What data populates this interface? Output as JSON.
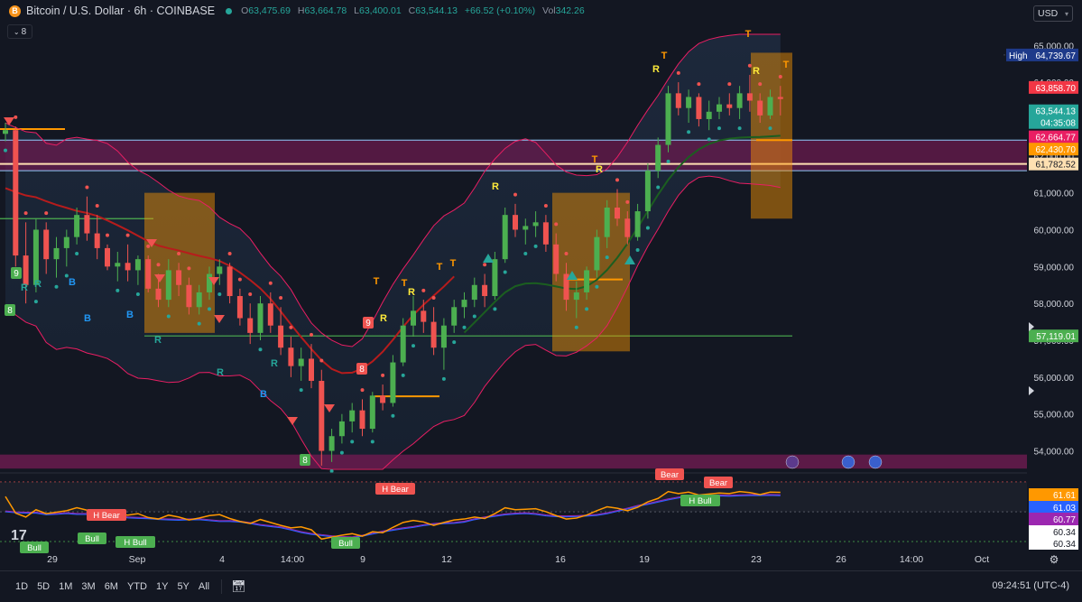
{
  "header": {
    "symbol_title": "Bitcoin / U.S. Dollar · 6h · COINBASE",
    "coin_glyph": "B",
    "open_label": "O",
    "open": "63,475.69",
    "high_label": "H",
    "high": "63,664.78",
    "low_label": "L",
    "low": "63,400.01",
    "close_label": "C",
    "close": "63,544.13",
    "change": "+66.52 (+0.10%)",
    "vol_label": "Vol",
    "vol": "342.26",
    "currency": "USD",
    "indicator_count": "8"
  },
  "price_axis": {
    "ticks": [
      "65,000.00",
      "64,000.00",
      "63,000.00",
      "62,000.00",
      "61,000.00",
      "60,000.00",
      "59,000.00",
      "58,000.00",
      "57,000.00",
      "56,000.00",
      "55,000.00",
      "54,000.00"
    ],
    "high_label": "High",
    "high_value": "64,739.67",
    "badges": [
      {
        "text": "63,858.70",
        "color": "#f23645"
      },
      {
        "text": "63,544.13",
        "color": "#26a69a"
      },
      {
        "text": "04:35:08",
        "color": "#26a69a"
      },
      {
        "text": "62,664.77",
        "color": "#e91e63"
      },
      {
        "text": "62,430.70",
        "color": "#ff9800"
      },
      {
        "text": "61,782.52",
        "color": "#ffe0b2"
      },
      {
        "text": "57,119.01",
        "color": "#4caf50"
      }
    ]
  },
  "osc_axis": {
    "badges": [
      {
        "text": "61.61",
        "color": "#ff9800"
      },
      {
        "text": "61.03",
        "color": "#2962ff"
      },
      {
        "text": "60.77",
        "color": "#9c27b0"
      },
      {
        "text": "60.34",
        "color": "#ffffff"
      },
      {
        "text": "60.34",
        "color": "#ffffff"
      }
    ]
  },
  "time_axis": {
    "ticks": [
      "29",
      "Sep",
      "4",
      "14:00",
      "9",
      "12",
      "16",
      "19",
      "23",
      "26",
      "14:00",
      "Oct"
    ]
  },
  "signals": {
    "R": "R",
    "T": "T",
    "B": "B",
    "nine": "9",
    "eight": "8",
    "h_bear": "H Bear",
    "h_bull": "H Bull",
    "bull": "Bull",
    "bear": "Bear"
  },
  "bottom_bar": {
    "timeframes": [
      "1D",
      "5D",
      "1M",
      "3M",
      "6M",
      "YTD",
      "1Y",
      "5Y",
      "All"
    ],
    "clock": "09:24:51 (UTC-4)"
  },
  "colors": {
    "up": "#26a69a",
    "down": "#ef5350",
    "background": "#131722",
    "band": "#e91e63",
    "ma": "#b71c1c",
    "green_ma": "#1b5e20",
    "orange": "#ff9800"
  },
  "chart_data": {
    "type": "candlestick",
    "title": "Bitcoin / U.S. Dollar · 6h · COINBASE",
    "ylim": [
      53500,
      65300
    ],
    "candles": [
      [
        62600,
        62900,
        62400,
        62700
      ],
      [
        62700,
        62800,
        59000,
        59300
      ],
      [
        59300,
        60200,
        58000,
        58500
      ],
      [
        58500,
        60300,
        58300,
        60000
      ],
      [
        60000,
        60200,
        58800,
        59200
      ],
      [
        59200,
        59800,
        58700,
        59500
      ],
      [
        59500,
        60000,
        59000,
        59800
      ],
      [
        59800,
        60600,
        59600,
        60400
      ],
      [
        60400,
        60900,
        59700,
        59900
      ],
      [
        59900,
        60400,
        59200,
        59500
      ],
      [
        59500,
        59600,
        58900,
        59000
      ],
      [
        59000,
        59400,
        58600,
        59100
      ],
      [
        59100,
        59600,
        58600,
        58900
      ],
      [
        58900,
        59300,
        58500,
        59200
      ],
      [
        59200,
        59300,
        58300,
        58400
      ],
      [
        58400,
        58800,
        57900,
        58100
      ],
      [
        58100,
        59200,
        57900,
        58900
      ],
      [
        58900,
        59100,
        58200,
        58500
      ],
      [
        58500,
        58700,
        57700,
        57900
      ],
      [
        57900,
        58500,
        57700,
        58300
      ],
      [
        58300,
        59000,
        58100,
        58800
      ],
      [
        58800,
        59200,
        58500,
        59000
      ],
      [
        59000,
        59100,
        58000,
        58200
      ],
      [
        58200,
        58400,
        57400,
        57600
      ],
      [
        57600,
        58000,
        56900,
        57200
      ],
      [
        57200,
        58200,
        57000,
        58000
      ],
      [
        58000,
        58300,
        57200,
        57400
      ],
      [
        57400,
        57900,
        56600,
        56800
      ],
      [
        56800,
        57100,
        56000,
        56300
      ],
      [
        56300,
        56800,
        55900,
        56500
      ],
      [
        56500,
        56900,
        55700,
        55900
      ],
      [
        55900,
        56200,
        53600,
        54000
      ],
      [
        54000,
        54600,
        53700,
        54400
      ],
      [
        54400,
        55000,
        54200,
        54800
      ],
      [
        54800,
        55300,
        54500,
        55100
      ],
      [
        55100,
        55400,
        54400,
        54600
      ],
      [
        54600,
        55600,
        54500,
        55500
      ],
      [
        55500,
        55800,
        55100,
        55300
      ],
      [
        55300,
        56600,
        55200,
        56400
      ],
      [
        56400,
        57600,
        56300,
        57400
      ],
      [
        57400,
        58200,
        57100,
        57800
      ],
      [
        57800,
        58100,
        57200,
        57500
      ],
      [
        57500,
        57900,
        56600,
        56800
      ],
      [
        56800,
        57600,
        56200,
        57400
      ],
      [
        57400,
        58100,
        57200,
        57900
      ],
      [
        57900,
        58300,
        57600,
        58100
      ],
      [
        58100,
        58700,
        57900,
        58500
      ],
      [
        58500,
        58800,
        57900,
        58200
      ],
      [
        58200,
        59400,
        58100,
        59200
      ],
      [
        59200,
        60600,
        59100,
        60400
      ],
      [
        60400,
        60700,
        59800,
        60000
      ],
      [
        60000,
        60300,
        59600,
        60100
      ],
      [
        60100,
        60500,
        59800,
        60200
      ],
      [
        60200,
        60400,
        59400,
        59600
      ],
      [
        59600,
        59900,
        58600,
        58800
      ],
      [
        58800,
        59100,
        57800,
        58100
      ],
      [
        58100,
        58600,
        57600,
        58300
      ],
      [
        58300,
        59000,
        58100,
        58900
      ],
      [
        58900,
        60000,
        58700,
        59800
      ],
      [
        59800,
        60800,
        59500,
        60600
      ],
      [
        60600,
        61100,
        60100,
        60300
      ],
      [
        60300,
        60500,
        59600,
        59800
      ],
      [
        59800,
        60700,
        59700,
        60500
      ],
      [
        60500,
        61800,
        60300,
        61600
      ],
      [
        61600,
        62500,
        61400,
        62300
      ],
      [
        62300,
        63900,
        62100,
        63700
      ],
      [
        63700,
        64000,
        63100,
        63300
      ],
      [
        63300,
        63800,
        62900,
        63600
      ],
      [
        63600,
        63700,
        62800,
        63000
      ],
      [
        63000,
        63500,
        62700,
        63200
      ],
      [
        63200,
        63600,
        63000,
        63400
      ],
      [
        63400,
        63700,
        63100,
        63300
      ],
      [
        63300,
        63900,
        63000,
        63700
      ],
      [
        63700,
        64200,
        63200,
        63500
      ],
      [
        63500,
        63700,
        62900,
        63100
      ],
      [
        63100,
        63800,
        63000,
        63600
      ],
      [
        63600,
        63900,
        63100,
        63544
      ]
    ],
    "horizontal_levels": [
      62430.7,
      61782.52,
      57119.01,
      60300
    ]
  }
}
